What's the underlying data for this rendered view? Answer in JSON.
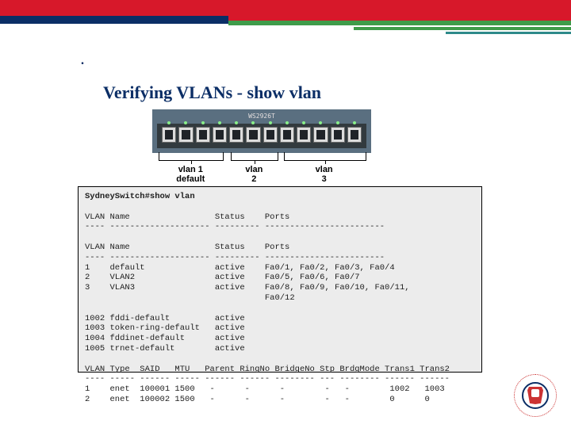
{
  "bullet_mark": ".",
  "heading": "Verifying VLANs - show vlan",
  "switch": {
    "model_label": "WS2926T",
    "port_count": 12
  },
  "brackets": [
    {
      "left_pct": 3,
      "width_pct": 29,
      "label": "vlan 1\ndefault"
    },
    {
      "left_pct": 36,
      "width_pct": 21,
      "label": "vlan\n2"
    },
    {
      "left_pct": 60,
      "width_pct": 37,
      "label": "vlan\n3"
    }
  ],
  "cli": {
    "prompt": "SydneySwitch#",
    "command": "show vlan",
    "header": "VLAN Name                 Status    Ports",
    "dashes": "---- -------------------- --------- ------------------------",
    "header2": "VLAN Name                 Status    Ports",
    "dashes2": "---- -------------------- --------- ------------------------",
    "rows": [
      "1    default              active    Fa0/1, Fa0/2, Fa0/3, Fa0/4",
      "2    VLAN2                active    Fa0/5, Fa0/6, Fa0/7",
      "3    VLAN3                active    Fa0/8, Fa0/9, Fa0/10, Fa0/11,",
      "                                    Fa0/12"
    ],
    "sys_rows": [
      "1002 fddi-default         active",
      "1003 token-ring-default   active",
      "1004 fddinet-default      active",
      "1005 trnet-default        active"
    ],
    "type_hdr": "VLAN Type  SAID   MTU   Parent RingNo BridgeNo Stp BrdgMode Trans1 Trans2",
    "type_dash": "---- ----- ------ ----- ------ ------ -------- --- -------- ------ ------",
    "type_rows": [
      "1    enet  100001 1500   -      -      -        -   -        1002   1003",
      "2    enet  100002 1500   -      -      -        -   -        0      0"
    ]
  },
  "chart_data": {
    "type": "table",
    "title": "show vlan",
    "columns": [
      "VLAN",
      "Name",
      "Status",
      "Ports"
    ],
    "rows": [
      {
        "VLAN": 1,
        "Name": "default",
        "Status": "active",
        "Ports": "Fa0/1, Fa0/2, Fa0/3, Fa0/4"
      },
      {
        "VLAN": 2,
        "Name": "VLAN2",
        "Status": "active",
        "Ports": "Fa0/5, Fa0/6, Fa0/7"
      },
      {
        "VLAN": 3,
        "Name": "VLAN3",
        "Status": "active",
        "Ports": "Fa0/8, Fa0/9, Fa0/10, Fa0/11, Fa0/12"
      },
      {
        "VLAN": 1002,
        "Name": "fddi-default",
        "Status": "active",
        "Ports": ""
      },
      {
        "VLAN": 1003,
        "Name": "token-ring-default",
        "Status": "active",
        "Ports": ""
      },
      {
        "VLAN": 1004,
        "Name": "fddinet-default",
        "Status": "active",
        "Ports": ""
      },
      {
        "VLAN": 1005,
        "Name": "trnet-default",
        "Status": "active",
        "Ports": ""
      }
    ],
    "type_table": {
      "columns": [
        "VLAN",
        "Type",
        "SAID",
        "MTU",
        "Parent",
        "RingNo",
        "BridgeNo",
        "Stp",
        "BrdgMode",
        "Trans1",
        "Trans2"
      ],
      "rows": [
        [
          1,
          "enet",
          100001,
          1500,
          "-",
          "-",
          "-",
          "-",
          "-",
          1002,
          1003
        ],
        [
          2,
          "enet",
          100002,
          1500,
          "-",
          "-",
          "-",
          "-",
          "-",
          0,
          0
        ]
      ]
    }
  }
}
